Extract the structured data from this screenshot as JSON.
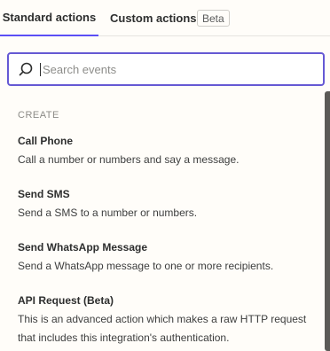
{
  "tabs": {
    "standard_label": "Standard actions",
    "custom_label": "Custom actions",
    "beta_badge": "Beta"
  },
  "search": {
    "placeholder": "Search events",
    "value": ""
  },
  "section": {
    "label": "CREATE"
  },
  "items": [
    {
      "title": "Call Phone",
      "description": "Call a number or numbers and say a message."
    },
    {
      "title": "Send SMS",
      "description": "Send a SMS to a number or numbers."
    },
    {
      "title": "Send WhatsApp Message",
      "description": "Send a WhatsApp message to one or more recipients."
    },
    {
      "title": "API Request (Beta)",
      "description": "This is an advanced action which makes a raw HTTP request that includes this integration's authentication."
    }
  ],
  "colors": {
    "accent": "#5b4ff5",
    "search_border": "#6559d4",
    "background": "#fffdf9"
  },
  "icons": {
    "search": "search-icon"
  }
}
